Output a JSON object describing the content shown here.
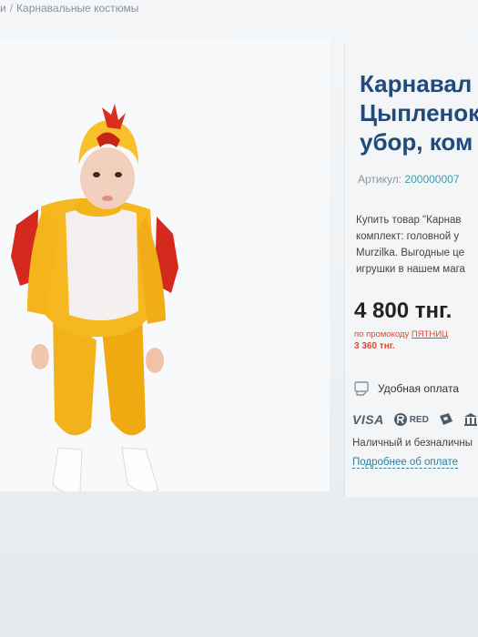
{
  "breadcrumb": {
    "prev": "и",
    "separator": "/",
    "current": "Карнавальные костюмы"
  },
  "product": {
    "title_lines": [
      "Карнавал",
      "Цыпленок",
      "убор, ком"
    ],
    "sku_label": "Артикул:",
    "sku_value": "200000007",
    "description_lines": [
      "Купить товар \"Карнав",
      "комплект: головной у",
      "Murzilka. Выгодные це",
      "игрушки в нашем мага"
    ],
    "price": "4 800 тнг.",
    "promo_prefix": "по промокоду",
    "promo_code": "ПЯТНИЦ",
    "promo_price": "3 360 тнг."
  },
  "payment": {
    "convenient_label": "Удобная оплата",
    "visa_label": "VISA",
    "red_label": "RED",
    "methods_text": "Наличный и безналичны",
    "more_link": "Подробнее об оплате"
  },
  "colors": {
    "title": "#1f4a7a",
    "sku_code": "#3aa0a8",
    "promo": "#e2452f",
    "link": "#2a7fa3"
  }
}
